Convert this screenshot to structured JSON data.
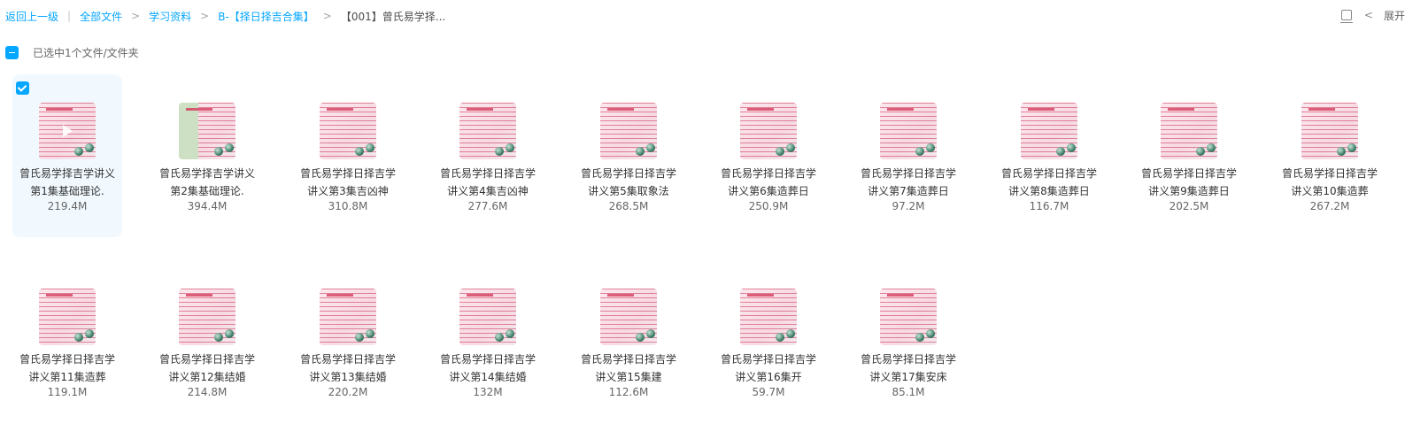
{
  "breadcrumb": {
    "back": "返回上一级",
    "items": [
      "全部文件",
      "学习资料",
      "B-【择日择吉合集】"
    ],
    "current": "【001】曾氏易学择..."
  },
  "toolbar": {
    "expand_label": "展开"
  },
  "selection": {
    "text": "已选中1个文件/文件夹"
  },
  "colors": {
    "accent": "#06a7ff",
    "selected_bg": "#f1f9ff"
  },
  "files": [
    {
      "name": "曾氏易学择吉学讲义第1集基础理论.",
      "size": "219.4M",
      "selected": true,
      "icon": "video-thumbnail"
    },
    {
      "name": "曾氏易学择吉学讲义第2集基础理论.",
      "size": "394.4M",
      "selected": false,
      "icon": "video-thumbnail"
    },
    {
      "name": "曾氏易学择日择吉学讲义第3集吉凶神",
      "size": "310.8M",
      "selected": false,
      "icon": "video-thumbnail"
    },
    {
      "name": "曾氏易学择日择吉学讲义第4集吉凶神",
      "size": "277.6M",
      "selected": false,
      "icon": "video-thumbnail"
    },
    {
      "name": "曾氏易学择日择吉学讲义第5集取象法",
      "size": "268.5M",
      "selected": false,
      "icon": "video-thumbnail"
    },
    {
      "name": "曾氏易学择日择吉学讲义第6集造葬日",
      "size": "250.9M",
      "selected": false,
      "icon": "video-thumbnail"
    },
    {
      "name": "曾氏易学择日择吉学讲义第7集造葬日",
      "size": "97.2M",
      "selected": false,
      "icon": "video-thumbnail"
    },
    {
      "name": "曾氏易学择日择吉学讲义第8集造葬日",
      "size": "116.7M",
      "selected": false,
      "icon": "video-thumbnail"
    },
    {
      "name": "曾氏易学择日择吉学讲义第9集造葬日",
      "size": "202.5M",
      "selected": false,
      "icon": "video-thumbnail"
    },
    {
      "name": "曾氏易学择日择吉学讲义第10集造葬",
      "size": "267.2M",
      "selected": false,
      "icon": "video-thumbnail"
    },
    {
      "name": "曾氏易学择日择吉学讲义第11集造葬",
      "size": "119.1M",
      "selected": false,
      "icon": "video-thumbnail"
    },
    {
      "name": "曾氏易学择日择吉学讲义第12集结婚",
      "size": "214.8M",
      "selected": false,
      "icon": "video-thumbnail"
    },
    {
      "name": "曾氏易学择日择吉学讲义第13集结婚",
      "size": "220.2M",
      "selected": false,
      "icon": "video-thumbnail"
    },
    {
      "name": "曾氏易学择日择吉学讲义第14集结婚",
      "size": "132M",
      "selected": false,
      "icon": "video-thumbnail"
    },
    {
      "name": "曾氏易学择日择吉学讲义第15集建",
      "size": "112.6M",
      "selected": false,
      "icon": "video-thumbnail"
    },
    {
      "name": "曾氏易学择日择吉学讲义第16集开",
      "size": "59.7M",
      "selected": false,
      "icon": "video-thumbnail"
    },
    {
      "name": "曾氏易学择日择吉学讲义第17集安床",
      "size": "85.1M",
      "selected": false,
      "icon": "video-thumbnail"
    }
  ]
}
